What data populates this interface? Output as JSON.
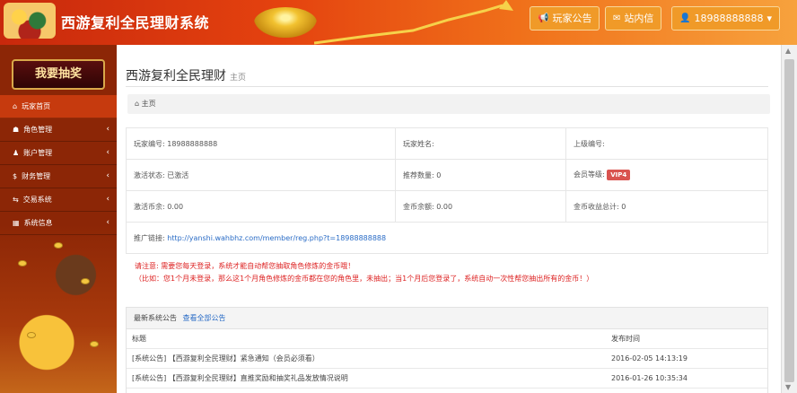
{
  "header": {
    "title": "西游复利全民理财系统",
    "buttons": {
      "notice": "玩家公告",
      "mail": "站内信",
      "user": "18988888888"
    }
  },
  "sidebar": {
    "lottery": "我要抽奖",
    "items": [
      {
        "label": "玩家首页",
        "icon": "home-icon"
      },
      {
        "label": "角色管理",
        "icon": "role-icon"
      },
      {
        "label": "账户管理",
        "icon": "user-icon"
      },
      {
        "label": "财务管理",
        "icon": "dollar-icon"
      },
      {
        "label": "交易系统",
        "icon": "exchange-icon"
      },
      {
        "label": "系统信息",
        "icon": "shop-icon"
      }
    ]
  },
  "page": {
    "title": "西游复利全民理财",
    "subtitle": "主页",
    "breadcrumb": "主页"
  },
  "info": {
    "row1": [
      "玩家编号: 18988888888",
      "玩家姓名:",
      "上级编号:"
    ],
    "row2a": "激活状态: 已激活",
    "row2b": "推荐数量: 0",
    "row2c_label": "会员等级:",
    "vip": "VIP4",
    "row3": [
      "激活币余: 0.00",
      "金币余额: 0.00",
      "金币收益总计: 0"
    ],
    "promo_label": "推广链接:",
    "promo_url": "http://yanshi.wahbhz.com/member/reg.php?t=18988888888"
  },
  "warning": {
    "line1": "请注意: 需要您每天登录，系统才能自动帮您抽取角色修炼的金币哦！",
    "line2": "（比如：您1个月未登录，那么这1个月角色修炼的金币都在您的角色里，未抽出；当1个月后您登录了，系统自动一次性帮您抽出所有的金币！）"
  },
  "notices": {
    "head": "最新系统公告",
    "view_all": "查看全部公告",
    "col_title": "标题",
    "col_time": "发布时间",
    "rows": [
      {
        "title": "[系统公告] 【西游复利全民理财】紧急通知（会员必须看）",
        "time": "2016-02-05 14:13:19"
      },
      {
        "title": "[系统公告] 【西游复利全民理财】直推奖励和抽奖礼品发放情况说明",
        "time": "2016-01-26 10:35:34"
      }
    ]
  },
  "colors": {
    "header_start": "#c8280c",
    "header_end": "#f7a23d",
    "sidebar": "#8c2606",
    "accent_button": "#f09a28",
    "warning": "#dd2222",
    "vip": "#d9534f"
  }
}
